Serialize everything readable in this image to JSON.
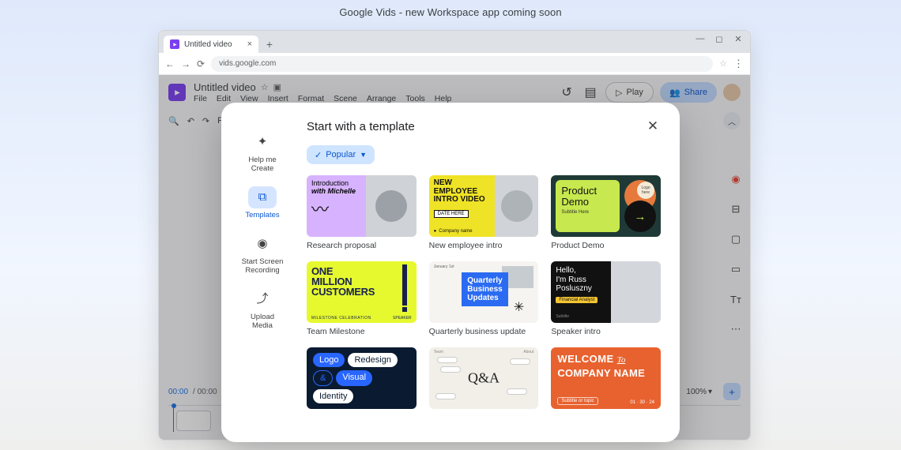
{
  "banner": "Google Vids - new Workspace app coming soon",
  "tab": {
    "title": "Untitled video"
  },
  "address": "vids.google.com",
  "app": {
    "title": "Untitled video",
    "menus": [
      "File",
      "Edit",
      "View",
      "Insert",
      "Format",
      "Scene",
      "Arrange",
      "Tools",
      "Help"
    ],
    "play": "Play",
    "share": "Share",
    "filter": "Fil…"
  },
  "timeline": {
    "current": "00:00",
    "total": "00:00",
    "zoom": "100%"
  },
  "modal": {
    "title": "Start with a template",
    "filter": "Popular",
    "sidebar": [
      {
        "label": "Help me\nCreate"
      },
      {
        "label": "Templates"
      },
      {
        "label": "Start Screen\nRecording"
      },
      {
        "label": "Upload\nMedia"
      }
    ],
    "cards": [
      {
        "label": "Research proposal",
        "art": {
          "line1": "Introduction",
          "line2": "with Michelle"
        }
      },
      {
        "label": "New employee intro",
        "art": {
          "headline": "NEW\nEMPLOYEE\nINTRO VIDEO",
          "tag": "DATE HERE",
          "company": "Company name"
        }
      },
      {
        "label": "Product Demo",
        "art": {
          "title": "Product\nDemo",
          "subtitle": "Subtitle Here",
          "logo": "Logo\nhere"
        }
      },
      {
        "label": "Team Milestone",
        "art": {
          "big": "ONE\nMILLION\nCUSTOMERS",
          "footL": "MILESTONE CELEBRATION",
          "footR": "SPEAKER"
        }
      },
      {
        "label": "Quarterly business update",
        "art": {
          "box": "Quarterly\nBusiness\nUpdates",
          "hdr": "January 1st"
        }
      },
      {
        "label": "Speaker intro",
        "art": {
          "text": "Hello,\nI'm Russ\nPosluszny",
          "tag": "Financial Analyst",
          "foot": "Subtitle"
        }
      },
      {
        "label": "",
        "art": {
          "p1": "Logo",
          "p2": "Redesign",
          "p3": "&",
          "p4": "Visual",
          "p5": "Identity"
        }
      },
      {
        "label": "",
        "art": {
          "qa": "Q&A",
          "tl": "Team",
          "tr": "About"
        }
      },
      {
        "label": "",
        "art": {
          "w1": "WELCOME",
          "to": "To",
          "w2": "COMPANY NAME",
          "sub": "Subtitle or topic",
          "date": "01 · 30 · 24"
        }
      }
    ]
  }
}
